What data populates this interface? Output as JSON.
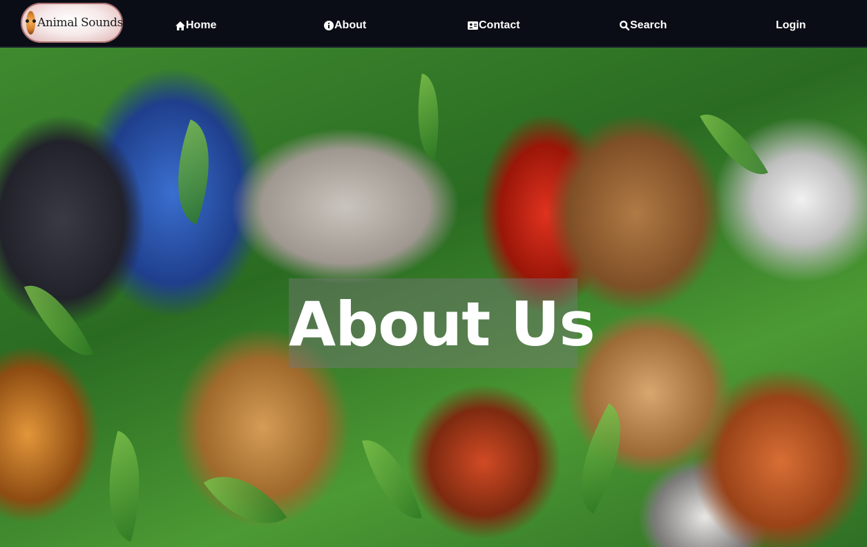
{
  "navbar": {
    "logo": {
      "text": "Animal Sounds",
      "icon": "tiger-logo-icon"
    },
    "links": [
      {
        "label": "Home",
        "icon": "home-icon"
      },
      {
        "label": "About",
        "icon": "info-icon"
      },
      {
        "label": "Contact",
        "icon": "contact-card-icon"
      },
      {
        "label": "Search",
        "icon": "search-icon"
      },
      {
        "label": "Login",
        "icon": ""
      }
    ]
  },
  "hero": {
    "title": "About Us",
    "background": "jungle-animals-illustration"
  },
  "colors": {
    "navbar_bg": "#0a0d15",
    "nav_text": "#ffffff",
    "title_text": "#ffffff"
  }
}
